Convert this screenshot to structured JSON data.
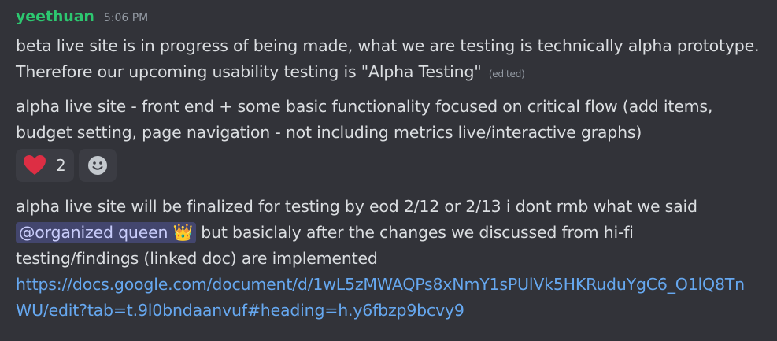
{
  "message": {
    "username": "yeethuan",
    "timestamp": "5:06 PM",
    "para1": {
      "line1": "beta live site is in progress of being made, what we are testing is technically alpha prototype.",
      "line2": "Therefore our upcoming usability testing is \"Alpha Testing\"",
      "edited": "(edited)"
    },
    "para2": {
      "line1": "alpha live site - front end + some basic functionality focused on critical flow (add items,",
      "line2": "budget setting, page navigation - not including metrics live/interactive graphs)"
    },
    "reactions": [
      {
        "emoji": "heart-emoji",
        "count": "2"
      },
      {
        "emoji": "add-reaction-icon"
      }
    ],
    "para3": {
      "line1": "alpha live site will be finalized for testing by eod 2/12 or 2/13 i dont rmb what we said",
      "mention": "@organized queen",
      "mention_emoji": "👑",
      "line2_rest": "but basiclaly after the changes we discussed from hi-fi",
      "line3": "testing/findings (linked doc) are implemented",
      "link_line1": "https://docs.google.com/document/d/1wL5zMWAQPs8xNmY1sPUlVk5HKRuduYgC6_O1lQ8Tn",
      "link_line2": "WU/edit?tab=t.9l0bndaanvuf#heading=h.y6fbzp9bcvy9"
    }
  },
  "colors": {
    "background": "#323339",
    "username": "#2dc770",
    "text": "#dbdee1",
    "muted": "#949ba4",
    "link": "#66a8f0",
    "mention_bg": "#43466e",
    "reaction_bg": "#3b3c43"
  }
}
